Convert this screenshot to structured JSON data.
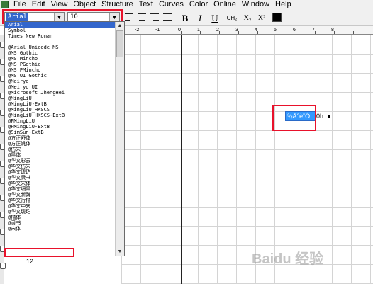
{
  "menubar": {
    "items": [
      "File",
      "Edit",
      "View",
      "Object",
      "Structure",
      "Text",
      "Curves",
      "Color",
      "Online",
      "Window",
      "Help"
    ]
  },
  "toolbar": {
    "font_value": "Arial",
    "size_value": "10",
    "bold": "B",
    "italic": "I",
    "underline": "U",
    "ch2": "CH₂",
    "subscript": "X₂",
    "superscript": "X²",
    "color": "#000000"
  },
  "ruler": {
    "labels": [
      "-2",
      "-1",
      "0",
      "1",
      "2",
      "3",
      "4",
      "5",
      "6",
      "7",
      "8"
    ]
  },
  "font_list": [
    "Arial",
    "Symbol",
    "Times New Roman",
    "",
    "@Arial Unicode MS",
    "@MS Gothic",
    "@MS Mincho",
    "@MS PGothic",
    "@MS PMincho",
    "@MS UI Gothic",
    "@Meiryo",
    "@Meiryo UI",
    "@Microsoft JhengHei",
    "@MingLiU",
    "@MingLiU-ExtB",
    "@MingLiU_HKSCS",
    "@MingLiU_HKSCS-ExtB",
    "@PMingLiU",
    "@PMingLiU-ExtB",
    "@SimSun-ExtB",
    "@方正舒体",
    "@方正姚体",
    "@仿宋",
    "@黑体",
    "@华文彩云",
    "@华文仿宋",
    "@华文琥珀",
    "@华文隶书",
    "@华文宋体",
    "@华文细黑",
    "@华文新魏",
    "@华文行楷",
    "@华文中宋",
    "@华文琥珀",
    "@楷体",
    "@隶书",
    "@宋体"
  ],
  "canvas": {
    "text_selected": "¾Å°è¨Ó",
    "text_after": "0h"
  },
  "left_panel_number": "12",
  "watermark": "Baidu 经验"
}
